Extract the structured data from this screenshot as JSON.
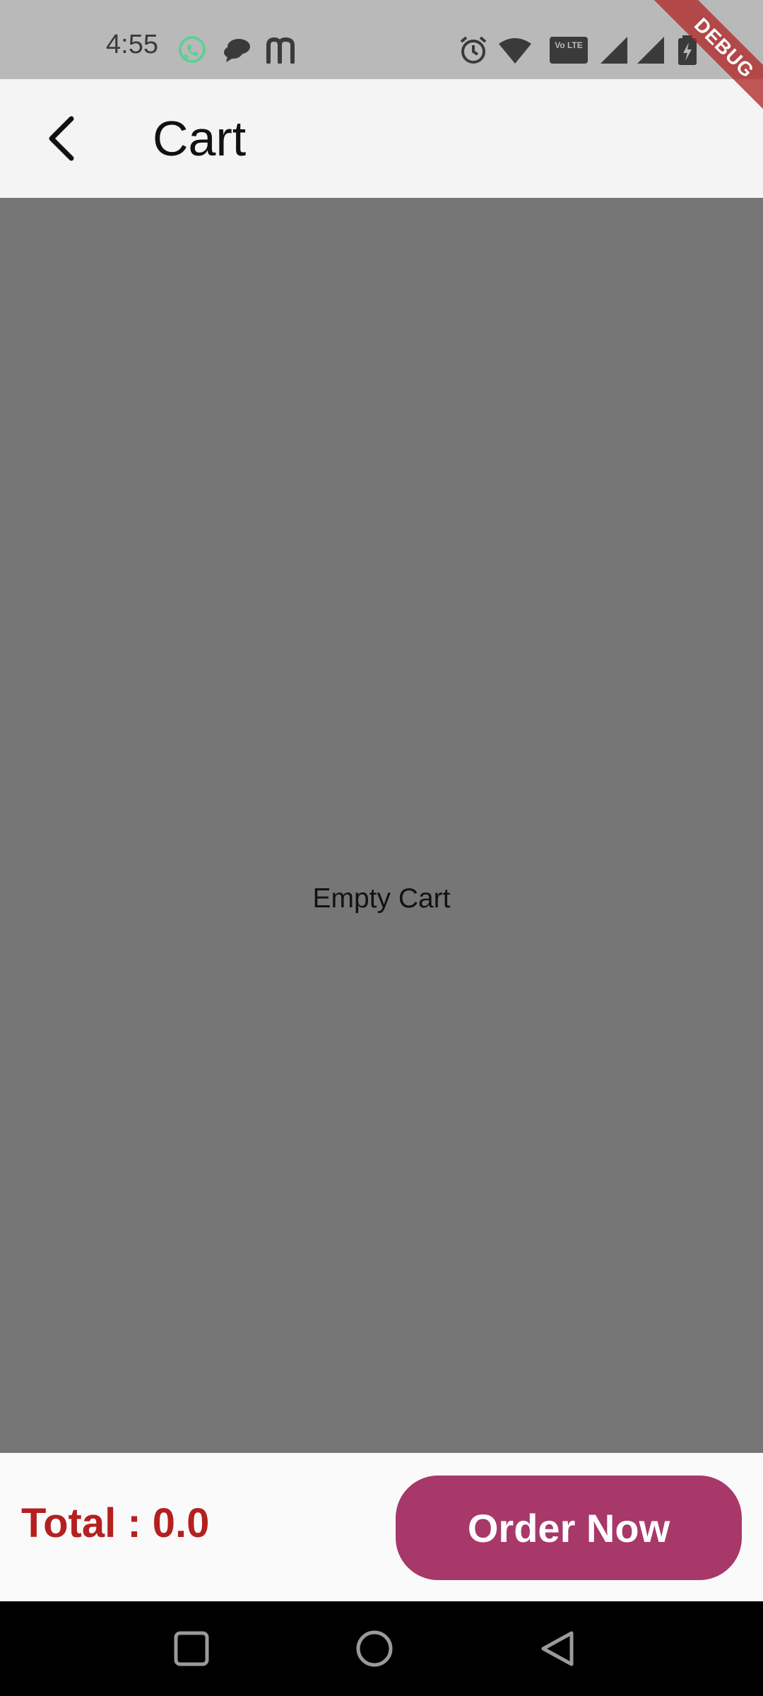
{
  "status_bar": {
    "time": "4:55",
    "left_icons": [
      "whatsapp-icon",
      "chat-bubble-icon",
      "m-app-icon"
    ],
    "right_icons": [
      "alarm-icon",
      "wifi-icon",
      "volte-icon",
      "signal-icon",
      "signal-icon",
      "battery-charging-icon"
    ],
    "volte_text": "Vo LTE"
  },
  "app_bar": {
    "title": "Cart",
    "back_icon": "chevron-left-icon"
  },
  "body": {
    "empty_message": "Empty Cart"
  },
  "bottom_bar": {
    "total_text": "Total : 0.0",
    "order_button_label": "Order Now"
  },
  "debug_banner": {
    "label": "DEBUG"
  },
  "nav_bar": {
    "buttons": [
      "recents-square-icon",
      "home-circle-icon",
      "back-triangle-icon"
    ]
  },
  "colors": {
    "status_bar_bg": "#b9b9b9",
    "app_bar_bg": "#f4f4f4",
    "body_bg": "#767676",
    "total_text": "#b42020",
    "order_button": "#a8386a",
    "whatsapp_green": "#5fcf95"
  }
}
